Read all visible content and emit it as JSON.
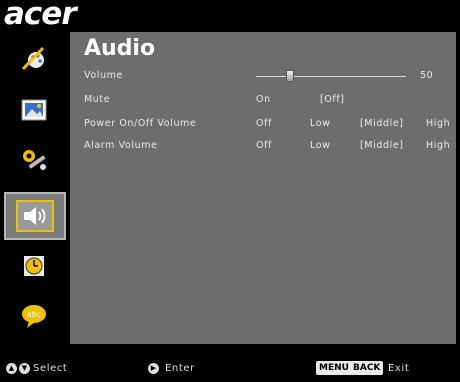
{
  "brand": {
    "logo_text": "acer"
  },
  "sidebar": {
    "items": [
      {
        "icon": "color-pen-icon",
        "active": false
      },
      {
        "icon": "image-icon",
        "active": false
      },
      {
        "icon": "settings-icon",
        "active": false
      },
      {
        "icon": "speaker-icon",
        "active": true
      },
      {
        "icon": "timer-icon",
        "active": false
      },
      {
        "icon": "language-icon",
        "active": false
      }
    ]
  },
  "main": {
    "title": "Audio",
    "volume": {
      "label": "Volume",
      "value": "50",
      "level": 0.25
    },
    "mute": {
      "label": "Mute",
      "options": [
        "On",
        "[Off]"
      ]
    },
    "power_volume": {
      "label": "Power On/Off Volume",
      "options": [
        "Off",
        "Low",
        "[Middle]",
        "High"
      ]
    },
    "alarm_volume": {
      "label": "Alarm Volume",
      "options": [
        "Off",
        "Low",
        "[Middle]",
        "High"
      ]
    }
  },
  "footer": {
    "select_label": "Select",
    "enter_label": "Enter",
    "menu_key": "MENU",
    "back_key": "BACK",
    "exit_label": "Exit"
  },
  "colors": {
    "panel": "#6d6d6d",
    "background": "#000000",
    "highlight": "#e8c400"
  }
}
